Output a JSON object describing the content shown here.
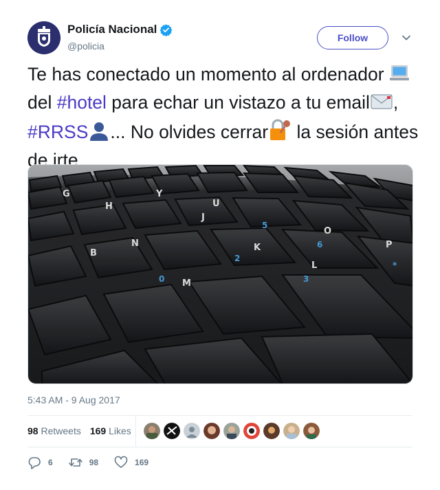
{
  "account": {
    "display_name": "Policía Nacional",
    "handle": "@policia",
    "verified": true,
    "avatar_icon": "police-badge-icon"
  },
  "follow_label": "Follow",
  "tweet": {
    "p1": "Te has conectado un momento al ordenador ",
    "e1": "💻",
    "p2": " del ",
    "h1": "#hotel",
    "p3": " para echar un vistazo a tu email",
    "e2": "📧",
    "p4": ", ",
    "h2": "#RRSS",
    "e3": "👤",
    "p5": "... No olvides cerrar",
    "e4": "🔐",
    "p6": " la sesión antes de irte"
  },
  "media": {
    "description_icon": "keyboard-photo"
  },
  "timestamp": "5:43 AM - 9 Aug 2017",
  "stats": {
    "retweets_count": "98",
    "retweets_label": "Retweets",
    "likes_count": "169",
    "likes_label": "Likes"
  },
  "actions": {
    "reply_count": "6",
    "retweet_count": "98",
    "like_count": "169"
  },
  "colors": {
    "hashtag": "#4a3ac6",
    "follow": "#4a4fc6",
    "verified": "#1da1f2",
    "muted": "#657786"
  }
}
